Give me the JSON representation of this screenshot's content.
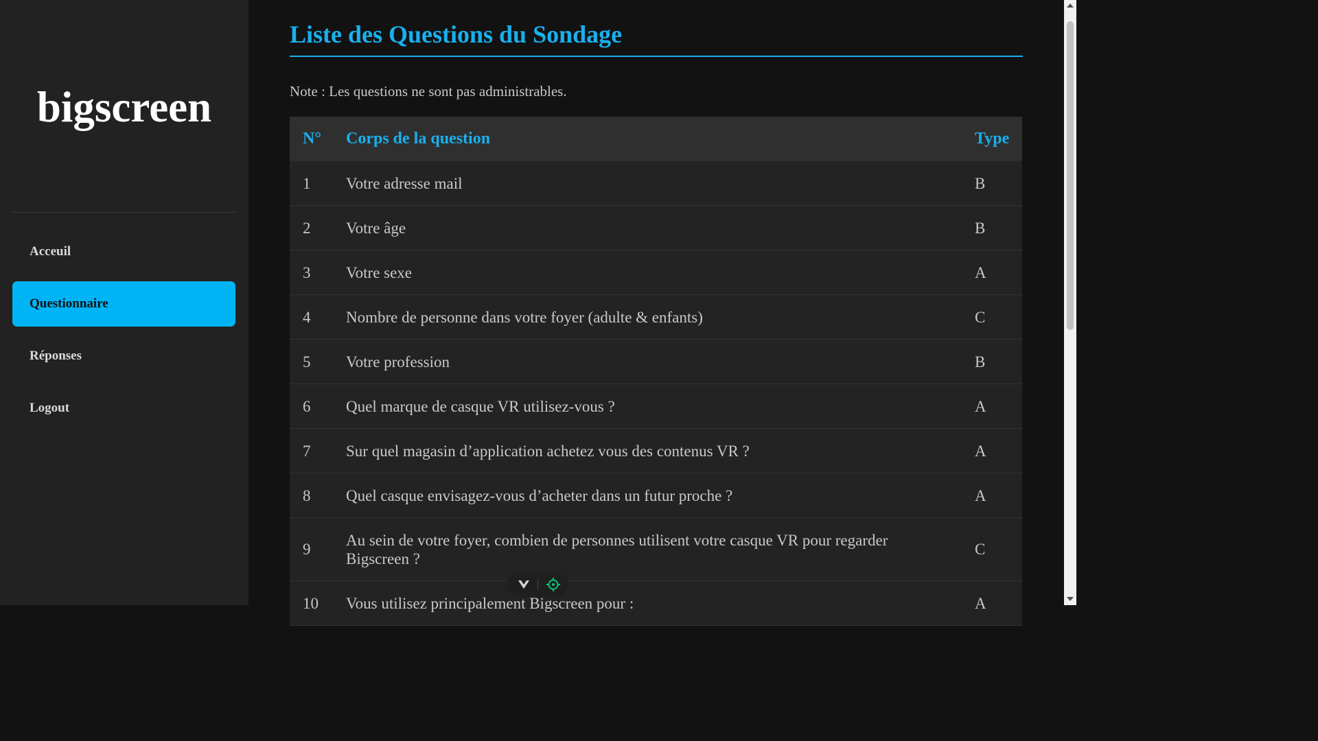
{
  "sidebar": {
    "brand": "bigscreen",
    "items": [
      {
        "label": "Acceuil",
        "active": false
      },
      {
        "label": "Questionnaire",
        "active": true
      },
      {
        "label": "Réponses",
        "active": false
      },
      {
        "label": "Logout",
        "active": false
      }
    ]
  },
  "main": {
    "title": "Liste des Questions du Sondage",
    "note": "Note : Les questions ne sont pas administrables.",
    "table": {
      "headers": {
        "number": "N°",
        "body": "Corps de la question",
        "type": "Type"
      },
      "rows": [
        {
          "number": "1",
          "body": "Votre adresse mail",
          "type": "B"
        },
        {
          "number": "2",
          "body": "Votre âge",
          "type": "B"
        },
        {
          "number": "3",
          "body": "Votre sexe",
          "type": "A"
        },
        {
          "number": "4",
          "body": "Nombre de personne dans votre foyer (adulte & enfants)",
          "type": "C"
        },
        {
          "number": "5",
          "body": "Votre profession",
          "type": "B"
        },
        {
          "number": "6",
          "body": "Quel marque de casque VR utilisez-vous ?",
          "type": "A"
        },
        {
          "number": "7",
          "body": "Sur quel magasin d’application achetez vous des contenus VR ?",
          "type": "A"
        },
        {
          "number": "8",
          "body": "Quel casque envisagez-vous d’acheter dans un futur proche ?",
          "type": "A"
        },
        {
          "number": "9",
          "body": "Au sein de votre foyer, combien de personnes utilisent votre casque VR pour regarder Bigscreen ?",
          "type": "C"
        },
        {
          "number": "10",
          "body": "Vous utilisez principalement Bigscreen pour :",
          "type": "A"
        }
      ]
    }
  },
  "overlay": {
    "icons": [
      "chevron-down-icon",
      "crosshair-icon"
    ],
    "accent": "#00c878"
  },
  "colors": {
    "accent": "#19b0ee",
    "active_nav": "#00b4f6",
    "sidebar_bg": "#222222",
    "main_bg": "#121212"
  }
}
